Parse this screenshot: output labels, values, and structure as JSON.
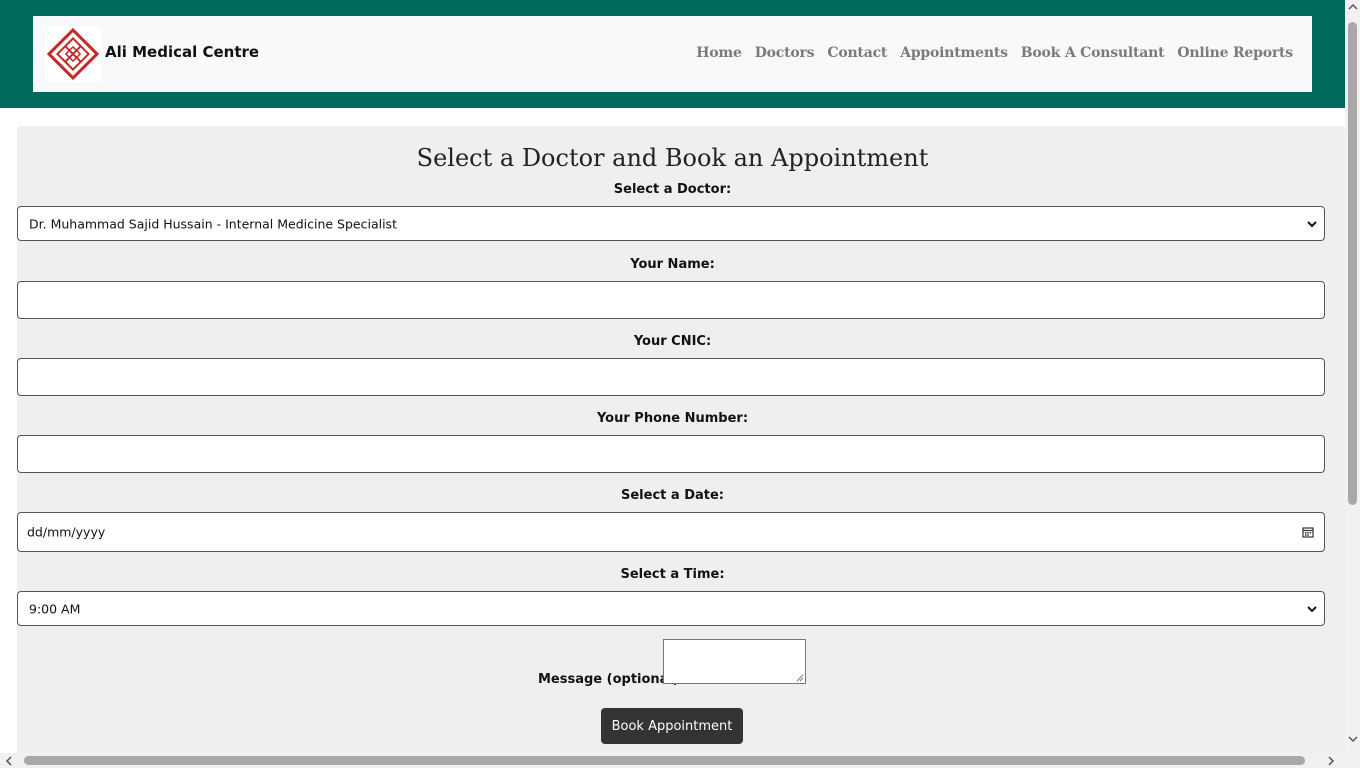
{
  "header": {
    "brand": "Ali Medical Centre",
    "logo_icon": "ali-medical-logo-icon",
    "nav": [
      "Home",
      "Doctors",
      "Contact",
      "Appointments",
      "Book A Consultant",
      "Online Reports"
    ],
    "colors": {
      "bar": "#00695c",
      "nav_text": "#7a7a7a",
      "logo": "#c62828"
    }
  },
  "form": {
    "title": "Select a Doctor and Book an Appointment",
    "doctor": {
      "label": "Select a Doctor:",
      "value": "Dr. Muhammad Sajid Hussain - Internal Medicine Specialist"
    },
    "name": {
      "label": "Your Name:",
      "value": ""
    },
    "cnic": {
      "label": "Your CNIC:",
      "value": ""
    },
    "phone": {
      "label": "Your Phone Number:",
      "value": ""
    },
    "date": {
      "label": "Select a Date:",
      "placeholder": "dd/mm/yyyy"
    },
    "time": {
      "label": "Select a Time:",
      "value": "9:00 AM"
    },
    "message": {
      "label": "Message (optional):",
      "value": ""
    },
    "submit_label": "Book Appointment"
  }
}
